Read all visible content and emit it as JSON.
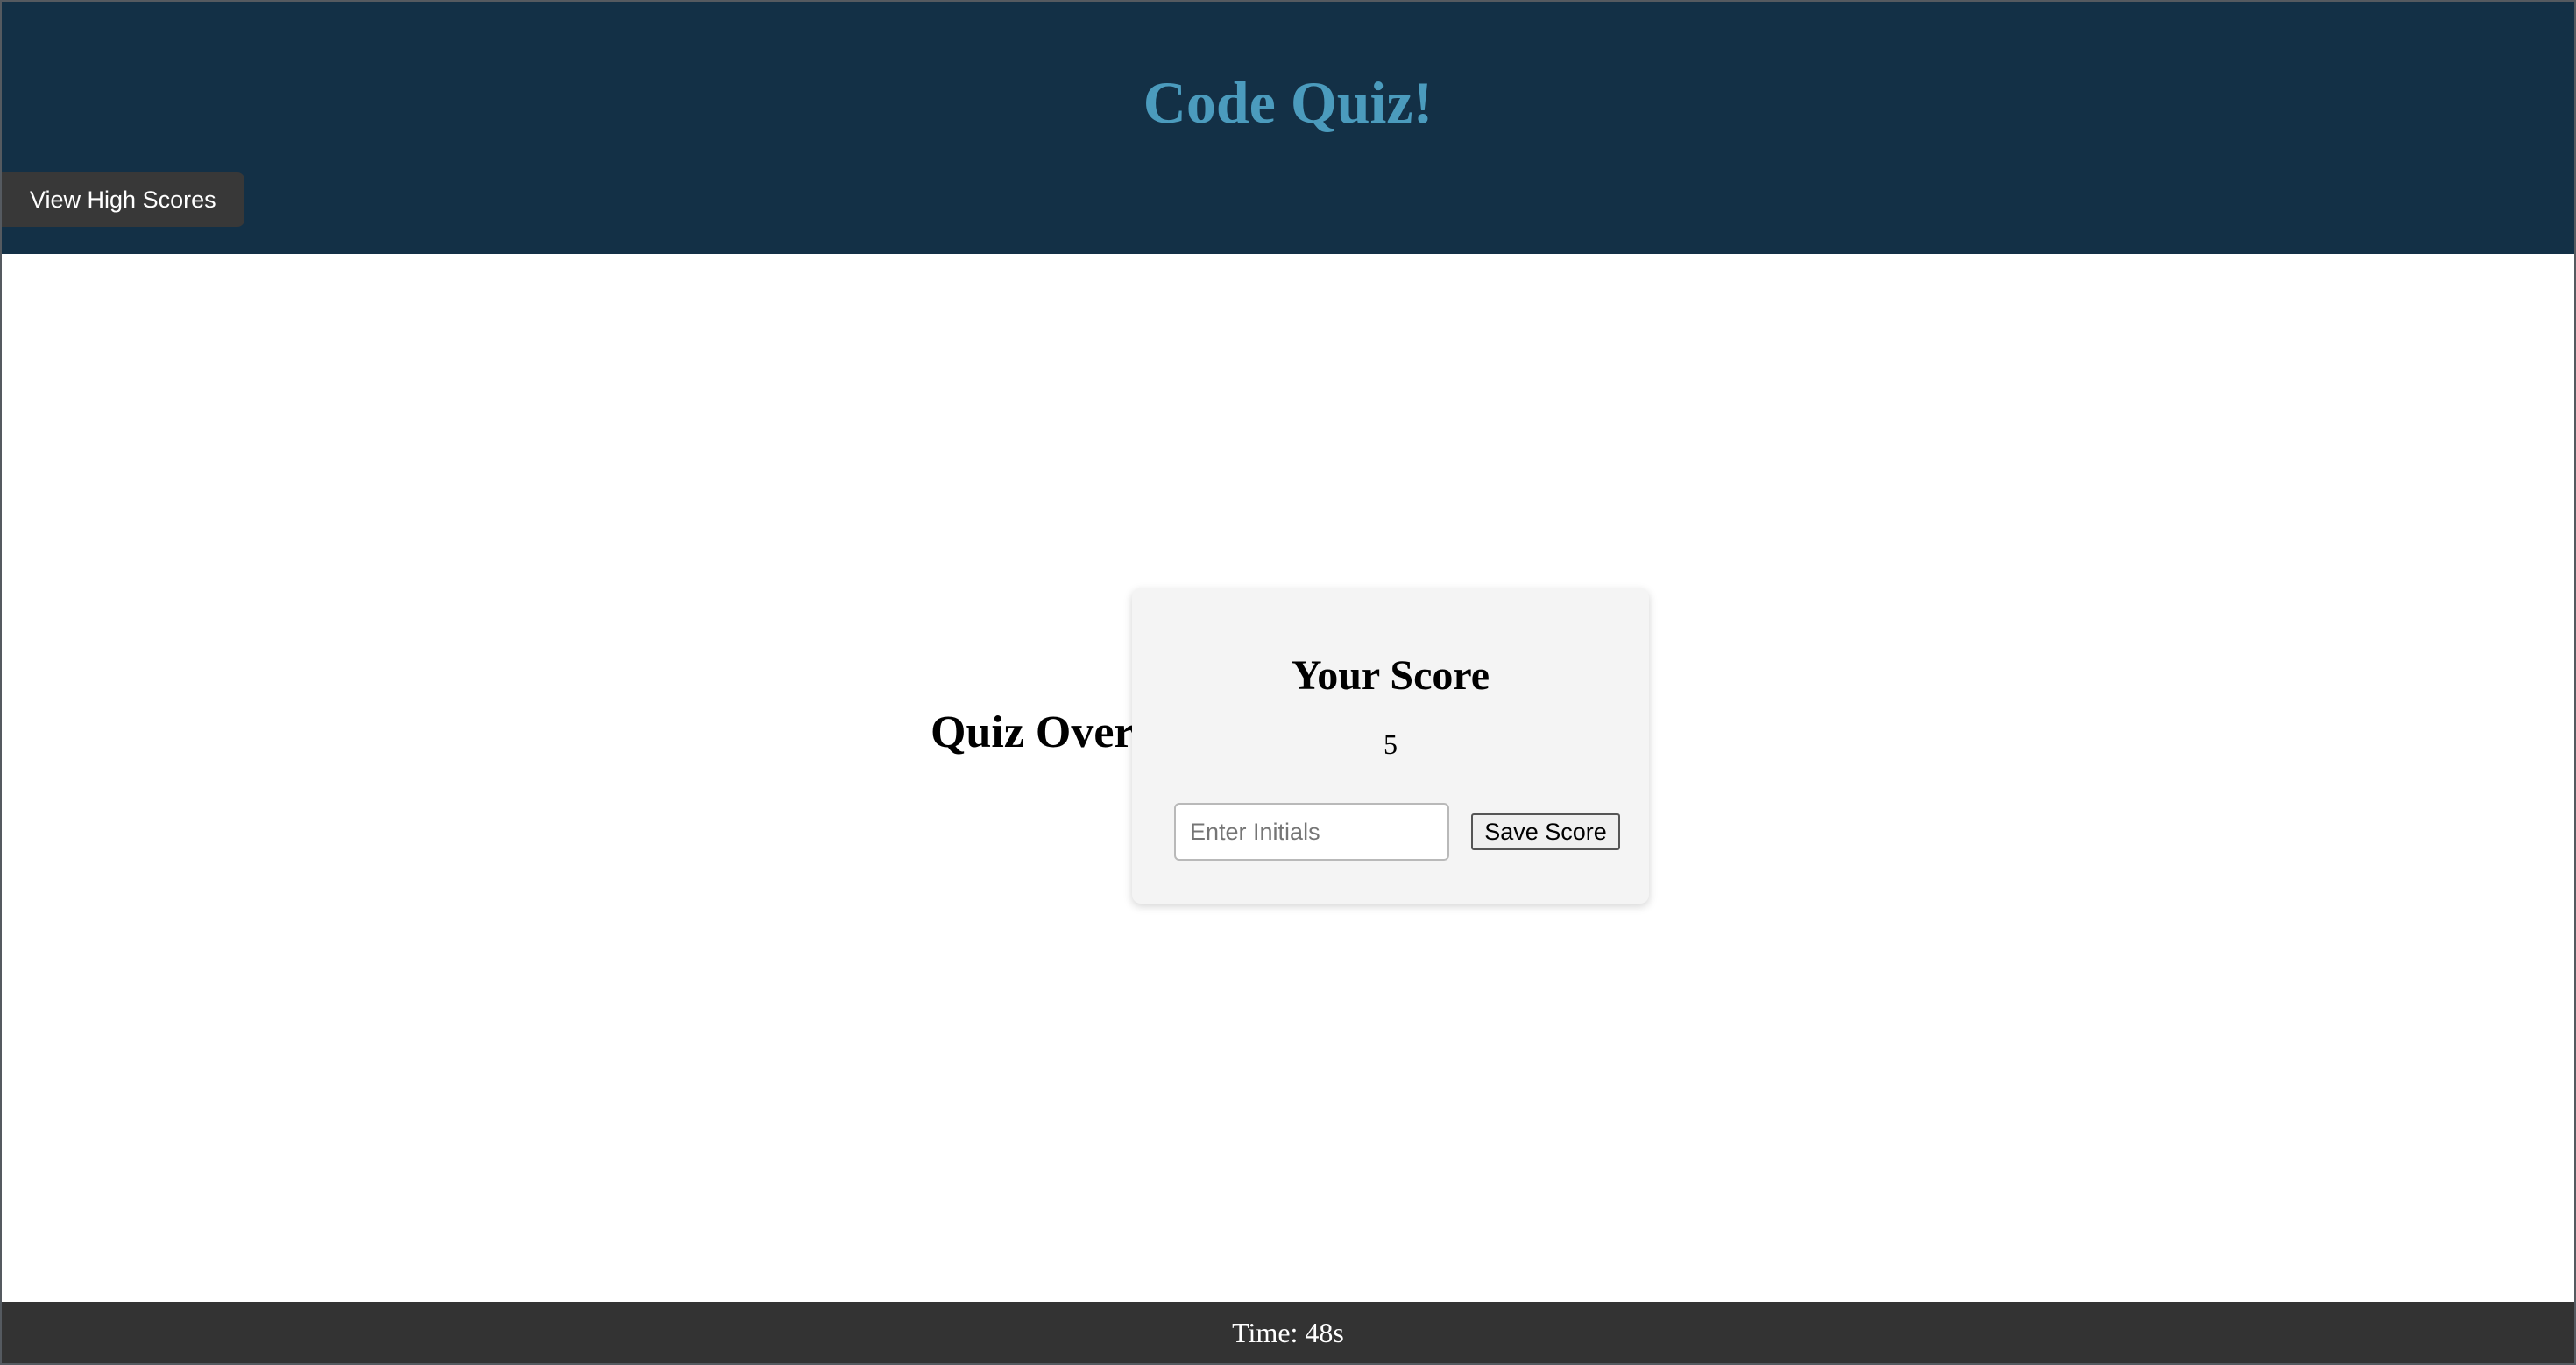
{
  "header": {
    "title": "Code Quiz!",
    "high_scores_label": "View High Scores"
  },
  "main": {
    "heading": "Quiz Over!",
    "score_card": {
      "heading": "Your Score",
      "score": "5",
      "initials_placeholder": "Enter Initials",
      "initials_value": "",
      "save_label": "Save Score"
    }
  },
  "footer": {
    "timer": "Time: 48s"
  },
  "colors": {
    "header_bg": "#133046",
    "title": "#4b9bbd",
    "button_dark": "#383838",
    "card_bg": "#f4f4f4",
    "footer_bg": "#333333"
  }
}
